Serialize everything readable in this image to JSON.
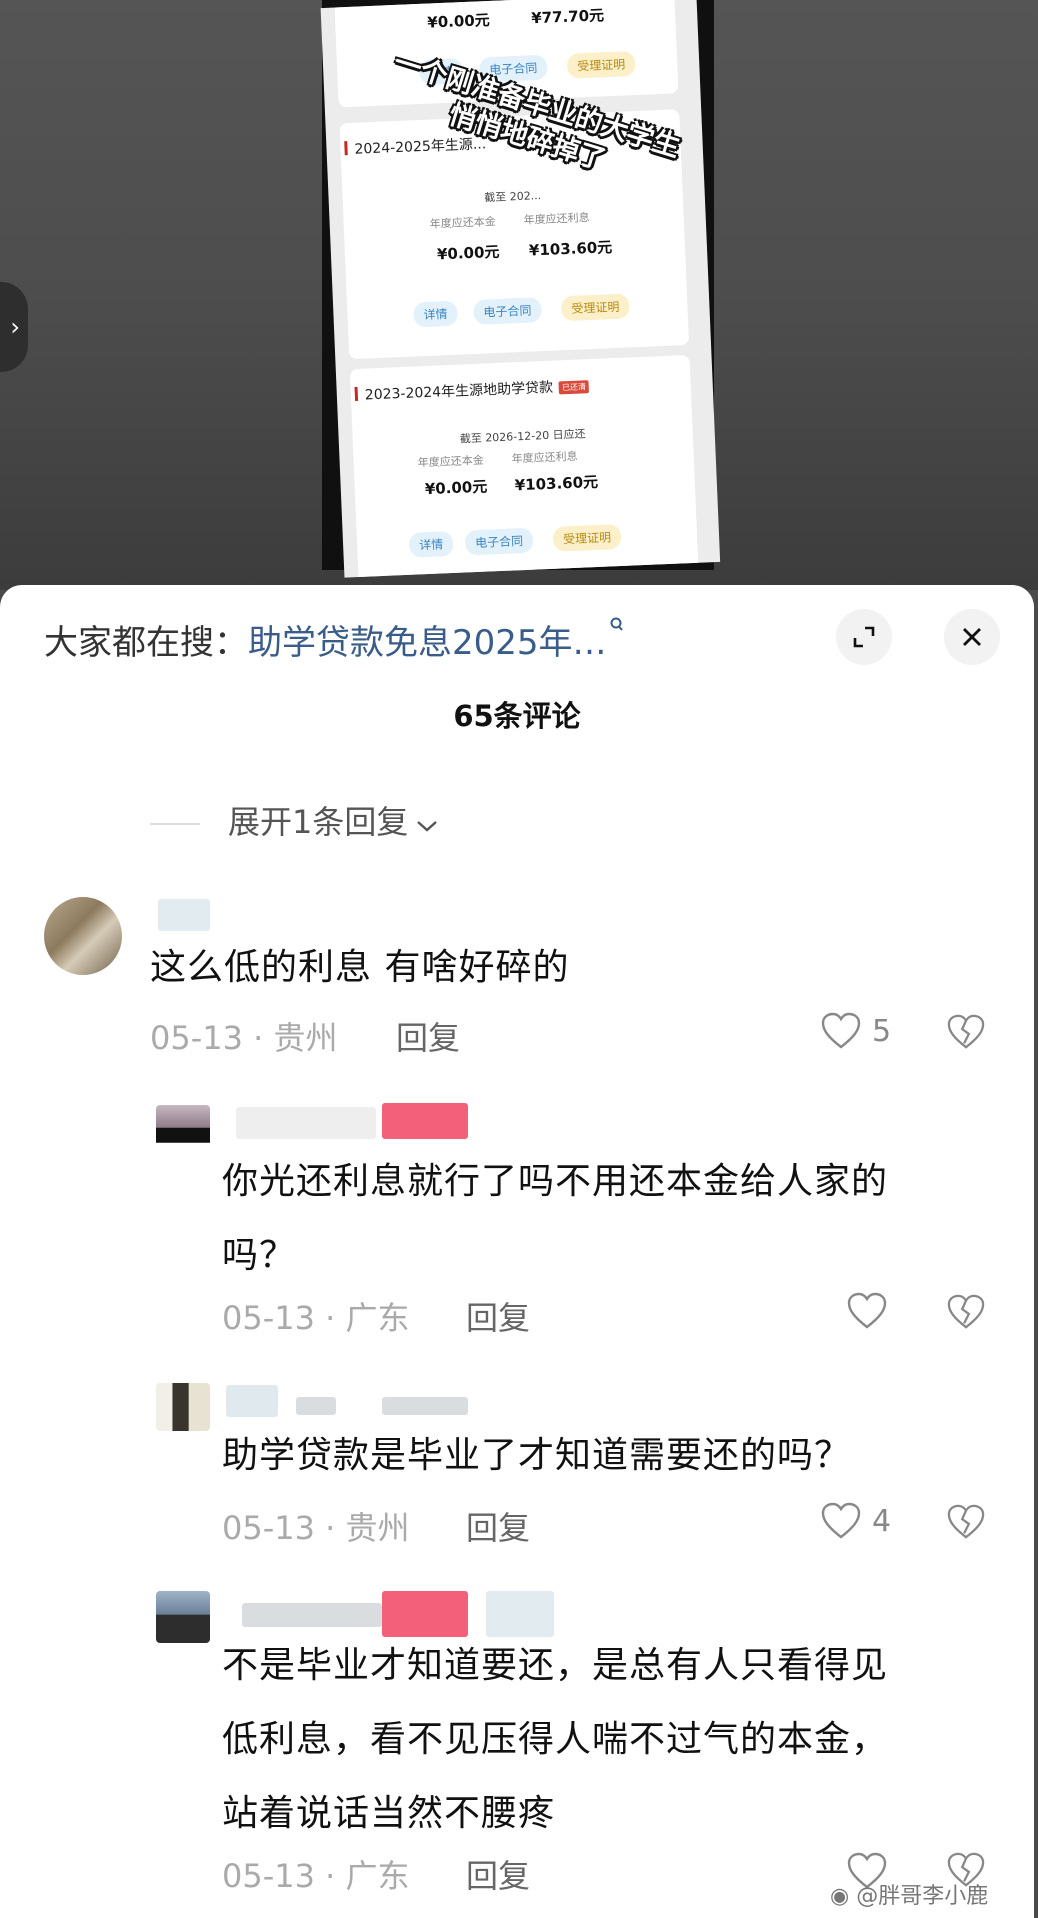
{
  "video": {
    "overlay_caption": "一个刚准备毕业的大学生悄悄地碎掉了",
    "loan_cards": [
      {
        "title": "",
        "tag": "",
        "due": "",
        "principal_label": "",
        "interest_label": "",
        "principal": "¥0.00元",
        "interest": "¥77.70元",
        "buttons": [
          "详情",
          "电子合同",
          "受理证明"
        ]
      },
      {
        "title": "2024-2025年生源...",
        "tag": "",
        "due": "截至 202...",
        "principal_label": "年度应还本金",
        "interest_label": "年度应还利息",
        "principal": "¥0.00元",
        "interest": "¥103.60元",
        "buttons": [
          "详情",
          "电子合同",
          "受理证明"
        ]
      },
      {
        "title": "2023-2024年生源地助学贷款",
        "tag": "已还清",
        "due": "截至 2026-12-20 日应还",
        "principal_label": "年度应还本金",
        "interest_label": "年度应还利息",
        "principal": "¥0.00元",
        "interest": "¥103.60元",
        "buttons": [
          "详情",
          "电子合同",
          "受理证明"
        ]
      }
    ]
  },
  "sheet": {
    "search_prefix": "大家都在搜：",
    "search_term": "助学贷款免息2025年…",
    "comment_count": "65条评论",
    "expand_replies": "展开1条回复"
  },
  "comments": [
    {
      "text": "这么低的利息 有啥好碎的",
      "date": "05-13",
      "location": "贵州",
      "reply_label": "回复",
      "likes": "5"
    },
    {
      "text_lines": [
        "你光还利息就行了吗不用还本金给人家的",
        "吗？"
      ],
      "date": "05-13",
      "location": "广东",
      "reply_label": "回复",
      "likes": ""
    },
    {
      "text": "助学贷款是毕业了才知道需要还的吗？",
      "date": "05-13",
      "location": "贵州",
      "reply_label": "回复",
      "likes": "4"
    },
    {
      "text_lines": [
        "不是毕业才知道要还，是总有人只看得见",
        "低利息，看不见压得人喘不过气的本金，",
        "站着说话当然不腰疼"
      ],
      "date": "05-13",
      "location": "广东",
      "reply_label": "回复",
      "likes": ""
    }
  ],
  "meta_separator": " · ",
  "watermark": "@胖哥李小鹿",
  "colors": {
    "link": "#3a5c8a",
    "meta": "#aaaaaa",
    "blur_red": "#f2607a"
  }
}
